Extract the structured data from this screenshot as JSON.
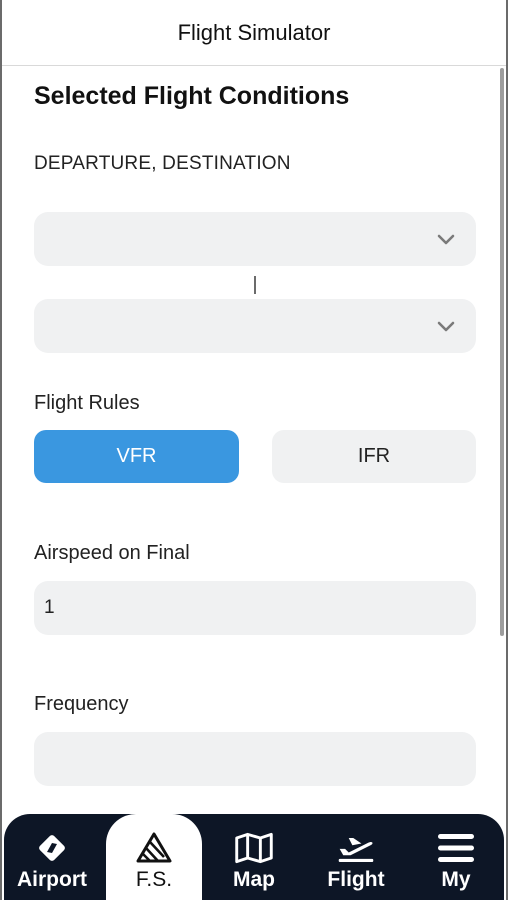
{
  "header": {
    "title": "Flight Simulator"
  },
  "section": {
    "title": "Selected Flight Conditions"
  },
  "route": {
    "label": "DEPARTURE, DESTINATION",
    "departure_value": "",
    "destination_value": ""
  },
  "rules": {
    "label": "Flight Rules",
    "options": [
      "VFR",
      "IFR"
    ],
    "selected": "VFR"
  },
  "airspeed": {
    "label": "Airspeed on Final",
    "value": "1"
  },
  "frequency": {
    "label": "Frequency",
    "value": ""
  },
  "tabs": [
    {
      "label": "Airport",
      "icon": "airport-diamond-icon",
      "active": false
    },
    {
      "label": "F.S.",
      "icon": "flight-simulator-icon",
      "active": true
    },
    {
      "label": "Map",
      "icon": "map-icon",
      "active": false
    },
    {
      "label": "Flight",
      "icon": "plane-departure-icon",
      "active": false
    },
    {
      "label": "My",
      "icon": "menu-icon",
      "active": false
    }
  ],
  "colors": {
    "accent": "#3a97e0",
    "tabbar": "#0d1626",
    "field": "#f0f1f2"
  }
}
